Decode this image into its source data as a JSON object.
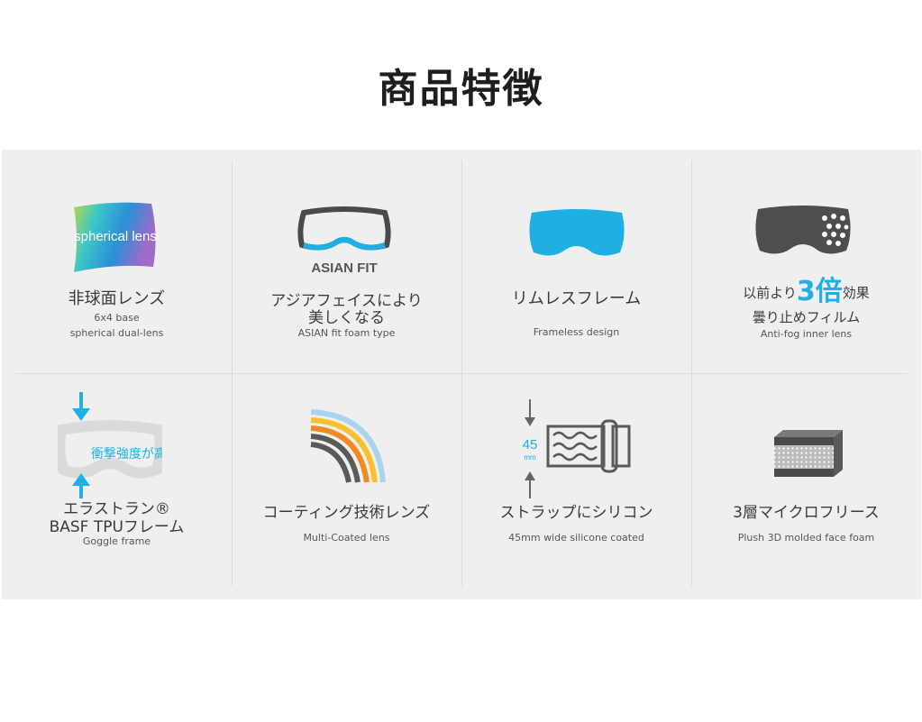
{
  "page": {
    "title": "商品特徴"
  },
  "colors": {
    "accent": "#1fb0e3",
    "panel": "#efefef",
    "dark": "#555555"
  },
  "features": [
    {
      "icon": "spherical-lens-icon",
      "icon_text": "spherical lens",
      "title": "非球面レンズ",
      "sub1": "6x4 base",
      "sub2": "spherical dual-lens"
    },
    {
      "icon": "asian-fit-goggle-icon",
      "icon_text": "ASIAN FIT",
      "title1": "アジアフェイスにより",
      "title2": "美しくなる",
      "sub": "ASIAN fit foam type"
    },
    {
      "icon": "frameless-lens-icon",
      "title": "リムレスフレーム",
      "sub": "Frameless design"
    },
    {
      "icon": "anti-fog-goggle-icon",
      "title_pre": "以前より",
      "title_big": "3倍",
      "title_post": "効果",
      "title2": "曇り止めフィルム",
      "sub": "Anti-fog inner lens"
    },
    {
      "icon": "frame-strength-icon",
      "icon_text": "衝撃強度が高い",
      "title1": "エラストラン®",
      "title2": "BASF TPUフレーム",
      "sub": "Goggle frame"
    },
    {
      "icon": "coating-layers-icon",
      "title": "コーティング技術レンズ",
      "sub": "Multi-Coated lens"
    },
    {
      "icon": "silicone-strap-icon",
      "icon_num": "45",
      "icon_unit": "mm",
      "title": "ストラップにシリコン",
      "sub": "45mm wide silicone coated"
    },
    {
      "icon": "face-foam-icon",
      "title": "3層マイクロフリース",
      "sub": "Plush 3D molded face foam"
    }
  ]
}
